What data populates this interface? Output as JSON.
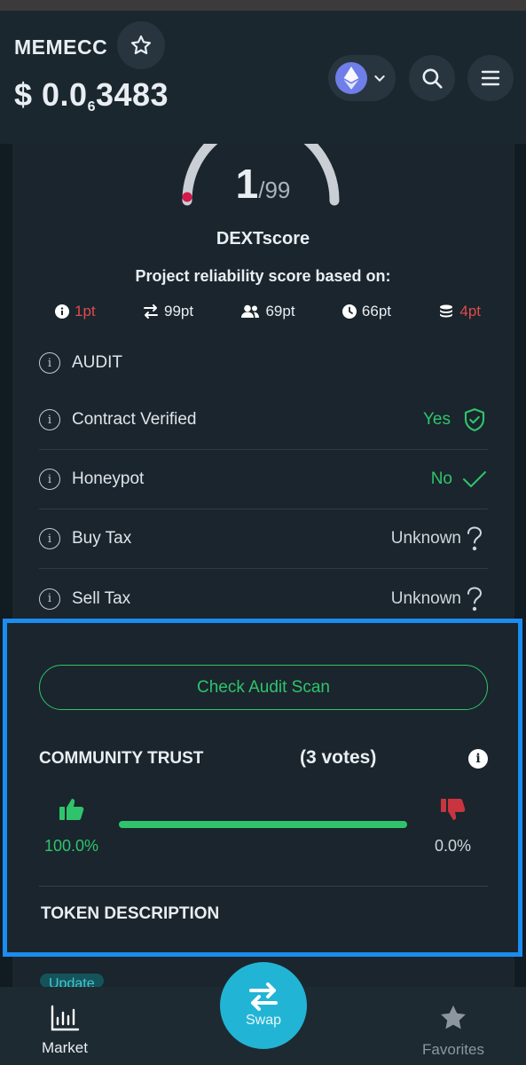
{
  "header": {
    "token_name": "MEMECC",
    "price_prefix": "$ 0.0",
    "price_zeros": "6",
    "price_digits": "3483"
  },
  "score": {
    "value": "1",
    "max": "/99",
    "label": "DEXTscore",
    "basis": "Project reliability score based on:",
    "metrics": [
      {
        "icon": "info-icon",
        "text": "1pt",
        "color": "#e04a4a"
      },
      {
        "icon": "transfer-icon",
        "text": "99pt",
        "color": "#e9eef2"
      },
      {
        "icon": "users-icon",
        "text": "69pt",
        "color": "#e9eef2"
      },
      {
        "icon": "clock-icon",
        "text": "66pt",
        "color": "#e9eef2"
      },
      {
        "icon": "coins-icon",
        "text": "4pt",
        "color": "#e04a4a"
      }
    ]
  },
  "audit": {
    "title": "AUDIT",
    "rows": [
      {
        "label": "Contract Verified",
        "value": "Yes",
        "icon": "shield-check-icon"
      },
      {
        "label": "Honeypot",
        "value": "No",
        "icon": "check-icon"
      },
      {
        "label": "Buy Tax",
        "value": "Unknown",
        "icon": "question-icon"
      },
      {
        "label": "Sell Tax",
        "value": "Unknown",
        "icon": "question-icon"
      }
    ],
    "scan_button": "Check Audit Scan"
  },
  "community": {
    "title": "COMMUNITY TRUST",
    "votes": "(3 votes)",
    "up_pct": "100.0%",
    "down_pct": "0.0%",
    "positive_fraction": 1.0
  },
  "description": {
    "title": "TOKEN DESCRIPTION",
    "update_label": "Update"
  },
  "nav": {
    "market": "Market",
    "swap": "Swap",
    "favorites": "Favorites"
  },
  "colors": {
    "accent_green": "#2fc46c",
    "accent_red": "#e04a4a",
    "swap_blue": "#22b4d4",
    "highlight_border": "#1c8cf0"
  }
}
